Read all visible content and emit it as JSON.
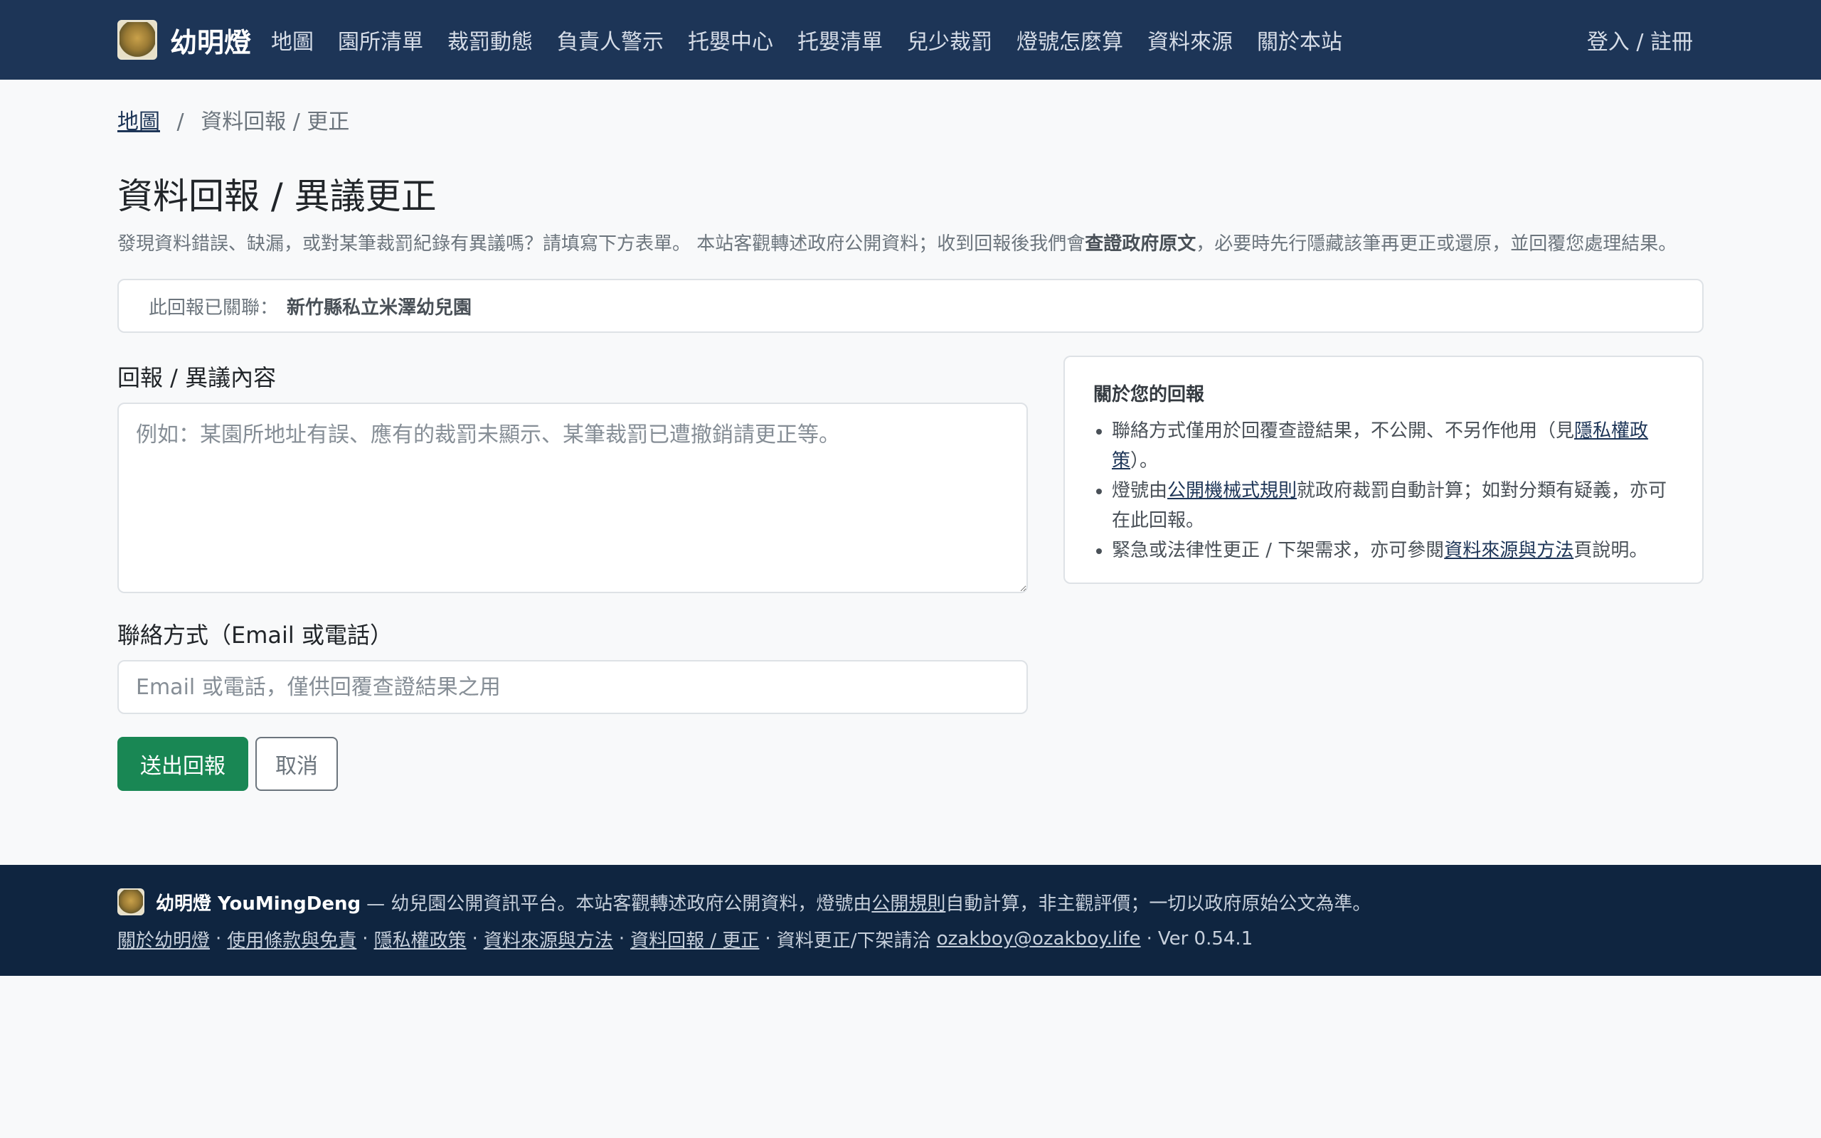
{
  "nav": {
    "brand": "幼明燈",
    "links": [
      "地圖",
      "園所清單",
      "裁罰動態",
      "負責人警示",
      "托嬰中心",
      "托嬰清單",
      "兒少裁罰",
      "燈號怎麼算",
      "資料來源",
      "關於本站"
    ],
    "login": "登入 / 註冊"
  },
  "breadcrumb": {
    "home": "地圖",
    "sep": "/",
    "current": "資料回報 / 更正"
  },
  "page": {
    "title": "資料回報 / 異議更正",
    "lead_1": "發現資料錯誤、缺漏，或對某筆裁罰紀錄有異議嗎？請填寫下方表單。 本站客觀轉述政府公開資料；收到回報後我們會",
    "lead_bold": "查證政府原文",
    "lead_2": "，必要時先行隱藏該筆再更正或還原，並回覆您處理結果。"
  },
  "association": {
    "label": "此回報已關聯：",
    "value": "新竹縣私立米澤幼兒園"
  },
  "form": {
    "content_label": "回報 / 異議內容",
    "content_placeholder": "例如：某園所地址有誤、應有的裁罰未顯示、某筆裁罰已遭撤銷請更正等。",
    "contact_label": "聯絡方式（Email 或電話）",
    "contact_placeholder": "Email 或電話，僅供回覆查證結果之用",
    "submit": "送出回報",
    "cancel": "取消"
  },
  "sidebar": {
    "title": "關於您的回報",
    "item1_a": "聯絡方式僅用於回覆查證結果，不公開、不另作他用（見",
    "item1_link": "隱私權政策",
    "item1_b": "）。",
    "item2_a": "燈號由",
    "item2_link": "公開機械式規則",
    "item2_b": "就政府裁罰自動計算；如對分類有疑義，亦可在此回報。",
    "item3_a": "緊急或法律性更正 / 下架需求，亦可參閱",
    "item3_link": "資料來源與方法",
    "item3_b": "頁說明。"
  },
  "footer": {
    "brand": "幼明燈 YouMingDeng",
    "tagline": "— 幼兒園公開資訊平台。本站客觀轉述政府公開資料，燈號由",
    "tagline_link": "公開規則",
    "tagline_2": "自動計算，非主觀評價；一切以政府原始公文為準。",
    "links": [
      "關於幼明燈",
      "使用條款與免責",
      "隱私權政策",
      "資料來源與方法",
      "資料回報 / 更正"
    ],
    "contact_text": "資料更正/下架請洽",
    "email": "ozakboy@ozakboy.life",
    "version": "Ver 0.54.1"
  },
  "colors": {
    "navbar": "#1d3557",
    "footer": "#0f2540",
    "primary": "#198754"
  }
}
